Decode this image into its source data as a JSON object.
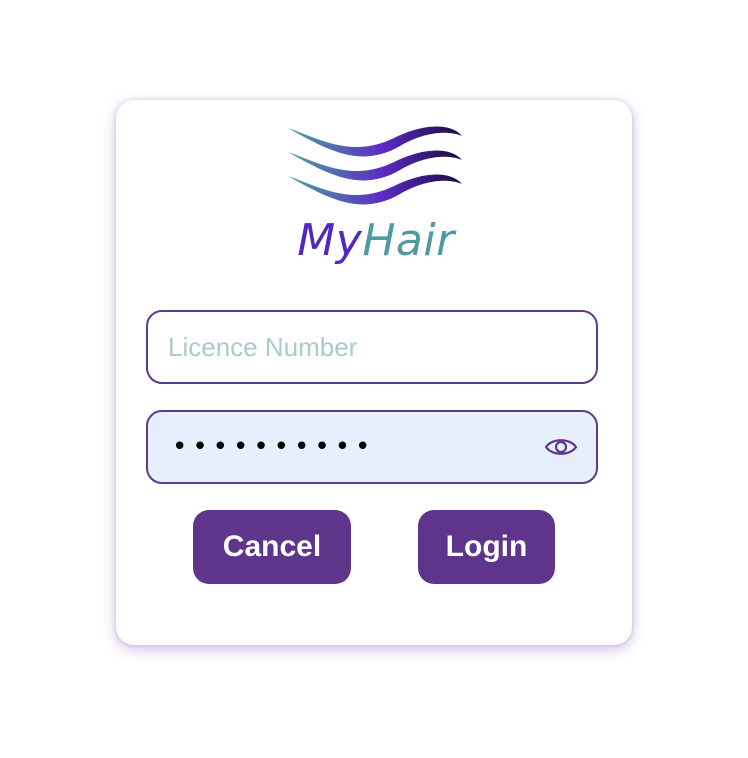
{
  "logo": {
    "text_part1": "My",
    "text_part2": "Hair",
    "colors": {
      "my": "#5127c0",
      "hair": "#4f9aa0",
      "wave_start": "#4fa3a3",
      "wave_mid": "#5a2bc4",
      "wave_end": "#1a0a3a"
    }
  },
  "form": {
    "licence": {
      "placeholder": "Licence Number",
      "value": ""
    },
    "password": {
      "masked_value": "••••••••••",
      "toggle_icon": "eye-icon"
    }
  },
  "buttons": {
    "cancel_label": "Cancel",
    "login_label": "Login"
  },
  "theme": {
    "accent": "#5f358c",
    "password_field_bg": "#e8effc"
  }
}
